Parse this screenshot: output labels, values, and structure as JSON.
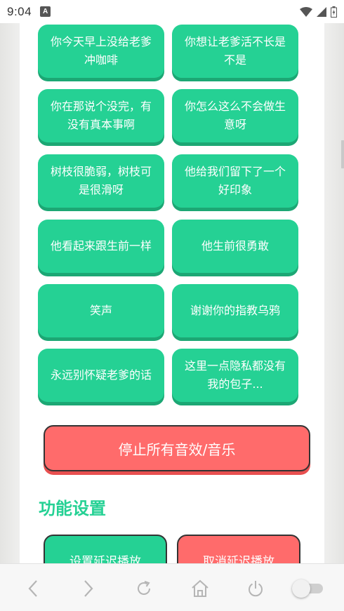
{
  "status_bar": {
    "time": "9:04",
    "app_icon": "A"
  },
  "sound_buttons": [
    "你今天早上没给老爹冲咖啡",
    "你想让老爹活不长是不是",
    "你在那说个没完，有没有真本事啊",
    "你怎么这么不会做生意呀",
    "树枝很脆弱，树枝可是很滑呀",
    "他给我们留下了一个好印象",
    "他看起来跟生前一样",
    "他生前很勇敢",
    "笑声",
    "谢谢你的指教乌鸦",
    "永远别怀疑老爹的话",
    "这里一点隐私都没有我的包子..."
  ],
  "stop_all_label": "停止所有音效/音乐",
  "settings": {
    "title": "功能设置",
    "set_delay_label": "设置延迟播放",
    "cancel_delay_label": "取消延迟播放"
  },
  "bottom_nav": {
    "items": [
      "back-icon",
      "forward-icon",
      "refresh-icon",
      "home-icon",
      "power-icon",
      "toggle"
    ]
  },
  "colors": {
    "primary_green": "#25d194",
    "accent_red": "#ff6b6b"
  }
}
